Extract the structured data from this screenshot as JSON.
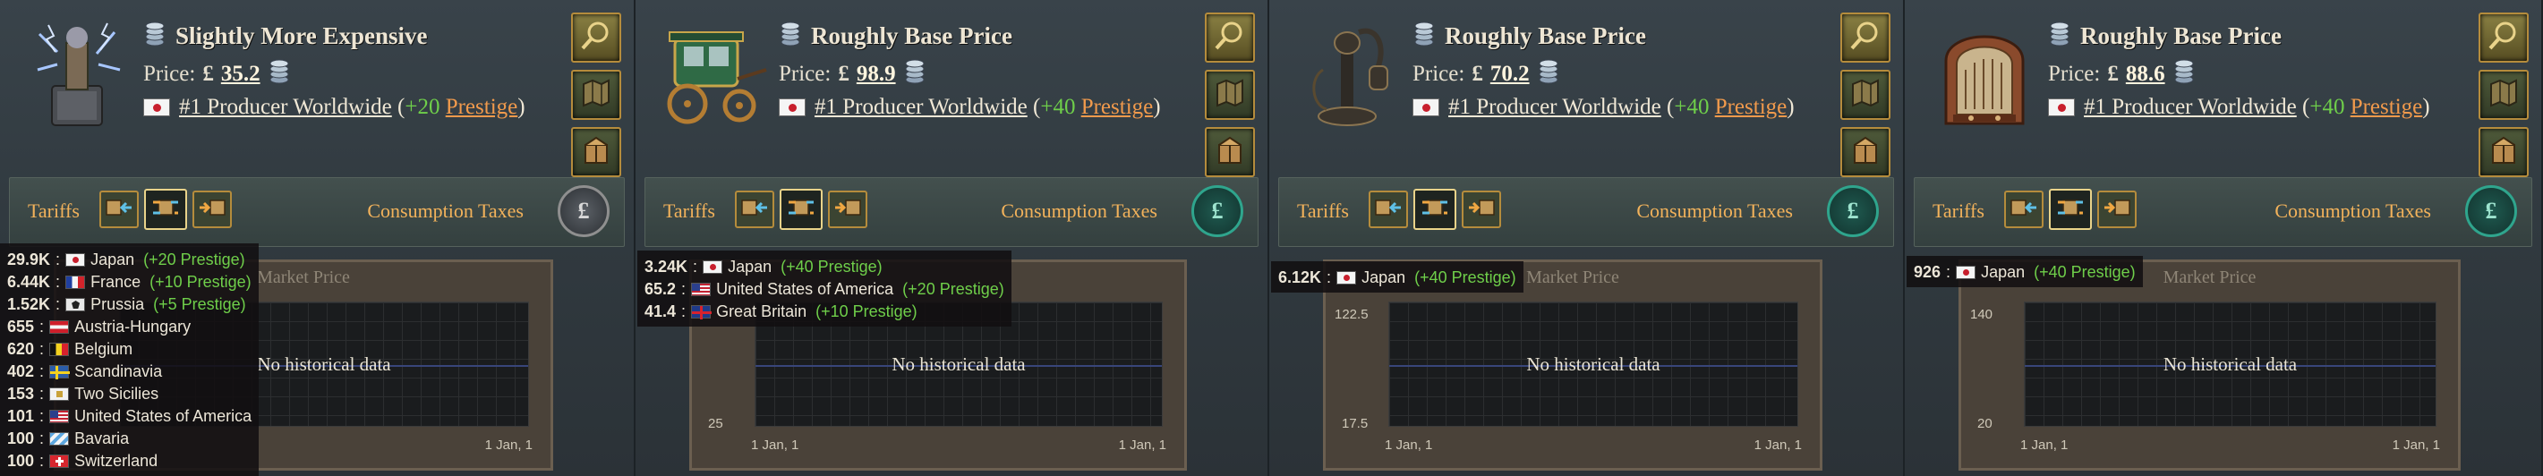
{
  "panels": [
    {
      "good": "electric-gear",
      "price_label": "Slightly More Expensive",
      "price_prefix": "Price:",
      "currency": "£",
      "price": "35.2",
      "rank_text": "#1 Producer Worldwide",
      "prestige_open": "(",
      "prestige_amount": "+20",
      "prestige_word": "Prestige",
      "prestige_close": ")",
      "tariffs_label": "Tariffs",
      "consumption_label": "Consumption Taxes",
      "consumption_icon": "£",
      "chart_title": "Market Price",
      "no_data": "No historical data",
      "y_top": "",
      "y_bottom": "",
      "x_left": "",
      "x_right": "1 Jan, 1"
    },
    {
      "good": "carriage",
      "price_label": "Roughly Base Price",
      "price_prefix": "Price:",
      "currency": "£",
      "price": "98.9",
      "rank_text": "#1 Producer Worldwide",
      "prestige_open": "(",
      "prestige_amount": "+40",
      "prestige_word": "Prestige",
      "prestige_close": ")",
      "tariffs_label": "Tariffs",
      "consumption_label": "Consumption Taxes",
      "consumption_icon": "£",
      "chart_title": "",
      "no_data": "No historical data",
      "y_top": "",
      "y_bottom": "25",
      "x_left": "1 Jan, 1",
      "x_right": "1 Jan, 1"
    },
    {
      "good": "telephone",
      "price_label": "Roughly Base Price",
      "price_prefix": "Price:",
      "currency": "£",
      "price": "70.2",
      "rank_text": "#1 Producer Worldwide",
      "prestige_open": "(",
      "prestige_amount": "+40",
      "prestige_word": "Prestige",
      "prestige_close": ")",
      "tariffs_label": "Tariffs",
      "consumption_label": "Consumption Taxes",
      "consumption_icon": "£",
      "chart_title": "Market Price",
      "no_data": "No historical data",
      "y_top": "122.5",
      "y_bottom": "17.5",
      "x_left": "1 Jan, 1",
      "x_right": "1 Jan, 1"
    },
    {
      "good": "radio",
      "price_label": "Roughly Base Price",
      "price_prefix": "Price:",
      "currency": "£",
      "price": "88.6",
      "rank_text": "#1 Producer Worldwide",
      "prestige_open": "(",
      "prestige_amount": "+40",
      "prestige_word": "Prestige",
      "prestige_close": ")",
      "tariffs_label": "Tariffs",
      "consumption_label": "Consumption Taxes",
      "consumption_icon": "£",
      "chart_title": "Market Price",
      "no_data": "No historical data",
      "y_top": "140",
      "y_bottom": "20",
      "x_left": "1 Jan, 1",
      "x_right": "1 Jan, 1"
    }
  ],
  "tooltips": [
    {
      "rows": [
        {
          "amount": "29.9K",
          "country": "Japan",
          "flag": "japan",
          "prestige": "(+20 Prestige)",
          "pcolor": "green"
        },
        {
          "amount": "6.44K",
          "country": "France",
          "flag": "france",
          "prestige": "(+10 Prestige)",
          "pcolor": "green"
        },
        {
          "amount": "1.52K",
          "country": "Prussia",
          "flag": "prussia",
          "prestige": "(+5 Prestige)",
          "pcolor": "green"
        },
        {
          "amount": "655",
          "country": "Austria-Hungary",
          "flag": "austria",
          "prestige": "",
          "pcolor": ""
        },
        {
          "amount": "620",
          "country": "Belgium",
          "flag": "belgium",
          "prestige": "",
          "pcolor": ""
        },
        {
          "amount": "402",
          "country": "Scandinavia",
          "flag": "scandinavia",
          "prestige": "",
          "pcolor": ""
        },
        {
          "amount": "153",
          "country": "Two Sicilies",
          "flag": "two-sicilies",
          "prestige": "",
          "pcolor": ""
        },
        {
          "amount": "101",
          "country": "United States of America",
          "flag": "usa",
          "prestige": "",
          "pcolor": ""
        },
        {
          "amount": "100",
          "country": "Bavaria",
          "flag": "bavaria",
          "prestige": "",
          "pcolor": ""
        },
        {
          "amount": "100",
          "country": "Switzerland",
          "flag": "switzerland",
          "prestige": "",
          "pcolor": ""
        }
      ]
    },
    {
      "rows": [
        {
          "amount": "3.24K",
          "country": "Japan",
          "flag": "japan",
          "prestige": "(+40 Prestige)",
          "pcolor": "green"
        },
        {
          "amount": "65.2",
          "country": "United States of America",
          "flag": "usa",
          "prestige": "(+20 Prestige)",
          "pcolor": "green"
        },
        {
          "amount": "41.4",
          "country": "Great Britain",
          "flag": "gb",
          "prestige": "(+10 Prestige)",
          "pcolor": "green"
        }
      ]
    },
    {
      "rows": [
        {
          "amount": "6.12K",
          "country": "Japan",
          "flag": "japan",
          "prestige": "(+40 Prestige)",
          "pcolor": "green"
        }
      ]
    },
    {
      "rows": [
        {
          "amount": "926",
          "country": "Japan",
          "flag": "japan",
          "prestige": "(+40 Prestige)",
          "pcolor": "green"
        }
      ]
    }
  ],
  "icons": {
    "side_buttons": [
      "magnifier-icon",
      "goods-map-icon",
      "trade-crate-icon"
    ],
    "tariff_buttons": [
      "import-icon",
      "neutral-trade-icon",
      "export-icon"
    ],
    "price_stack": "coin-stack-icon"
  },
  "colors": {
    "prestige_positive": "#6fcf4a",
    "prestige_word": "#f19a4c",
    "label_gold": "#f2b25b",
    "button_border": "#b58c3c"
  }
}
